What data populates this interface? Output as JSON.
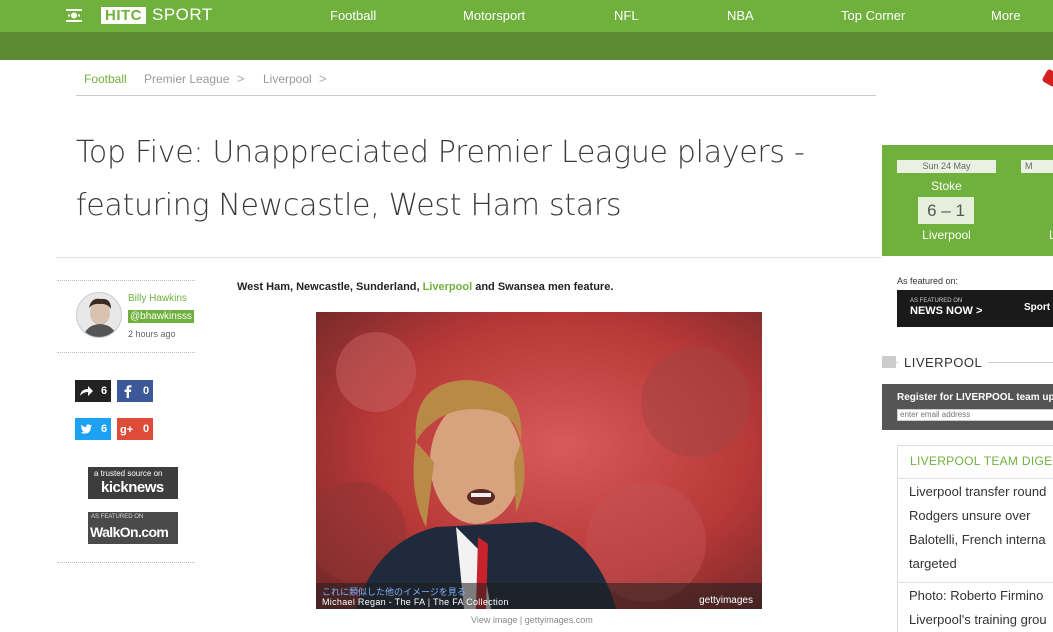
{
  "nav": {
    "logo_left": "HITC",
    "logo_right": "SPORT",
    "items": [
      "Football",
      "Motorsport",
      "NFL",
      "NBA",
      "Top Corner",
      "More"
    ]
  },
  "breadcrumb": [
    "Football",
    "Premier League",
    "Liverpool"
  ],
  "breadcrumb_sep": ">",
  "article": {
    "headline": "Top Five: Unappreciated Premier League players - featuring Newcastle, West Ham stars",
    "intro_prefix": "West Ham, Newcastle, Sunderland, ",
    "intro_link": "Liverpool",
    "intro_suffix": " and Swansea men feature.",
    "photo": {
      "caption_jp": "これに類似した他のイメージを見る",
      "credit": "Michael Regan - The FA | The FA Collection",
      "brand": "gettyimages",
      "view_link": "View image | gettyimages.com"
    }
  },
  "author": {
    "name": "Billy Hawkins",
    "handle": "@bhawkinsss",
    "time": "2 hours ago"
  },
  "share": {
    "shares": "6",
    "facebook": "0",
    "twitter": "6",
    "gplus": "0"
  },
  "badges": {
    "kick_top": "a trusted source on",
    "kick_main": "kicknews",
    "walk_top": "AS FEATURED ON",
    "walk_main": "WalkOn.com"
  },
  "score": {
    "date": "Sun 24 May",
    "date2": "M",
    "home": "Stoke",
    "result": "6 – 1",
    "away": "Liverpool",
    "away2": "L"
  },
  "featured": {
    "label": "As featured on:",
    "newsnow_top": "AS FEATURED ON",
    "newsnow_main": "NEWS NOW >",
    "sport": "Sport"
  },
  "section": "LIVERPOOL",
  "register": {
    "title": "Register for LIVERPOOL team up",
    "placeholder": "enter email address"
  },
  "digest": {
    "title": "LIVERPOOL TEAM DIGEST",
    "items": [
      [
        "Liverpool transfer round",
        "Rodgers unsure over",
        "Balotelli, French interna",
        "targeted"
      ],
      [
        "Photo: Roberto Firmino",
        "Liverpool's training grou"
      ]
    ]
  },
  "colors": {
    "brand_green": "#6fb13c",
    "dark_green": "#5b8a32"
  }
}
